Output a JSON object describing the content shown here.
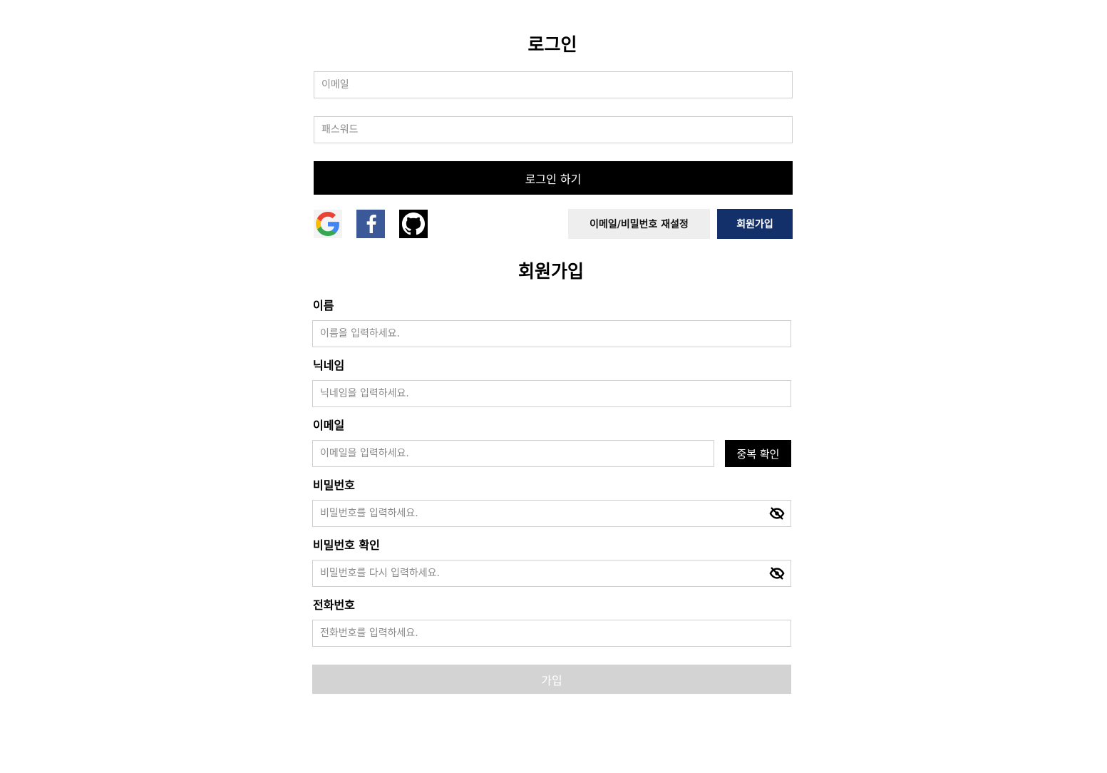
{
  "login": {
    "title": "로그인",
    "email_placeholder": "이메일",
    "password_placeholder": "패스워드",
    "submit_label": "로그인 하기",
    "social": [
      "google-icon",
      "facebook-icon",
      "github-icon"
    ],
    "reset_label": "이메일/비밀번호 재설정",
    "signup_label": "회원가입"
  },
  "signup": {
    "title": "회원가입",
    "name_label": "이름",
    "name_placeholder": "이름을 입력하세요.",
    "nickname_label": "닉네임",
    "nickname_placeholder": "닉네임을 입력하세요.",
    "email_label": "이메일",
    "email_placeholder": "이메일을 입력하세요.",
    "dup_check_label": "중복 확인",
    "password_label": "비밀번호",
    "password_placeholder": "비밀번호를 입력하세요.",
    "password_confirm_label": "비밀번호 확인",
    "password_confirm_placeholder": "비밀번호를 다시 입력하세요.",
    "phone_label": "전화번호",
    "phone_placeholder": "전화번호를 입력하세요.",
    "submit_label": "가입"
  },
  "colors": {
    "primary": "#000000",
    "accent_navy": "#14306a",
    "facebook": "#3b5998",
    "disabled": "#d3d3d3"
  }
}
